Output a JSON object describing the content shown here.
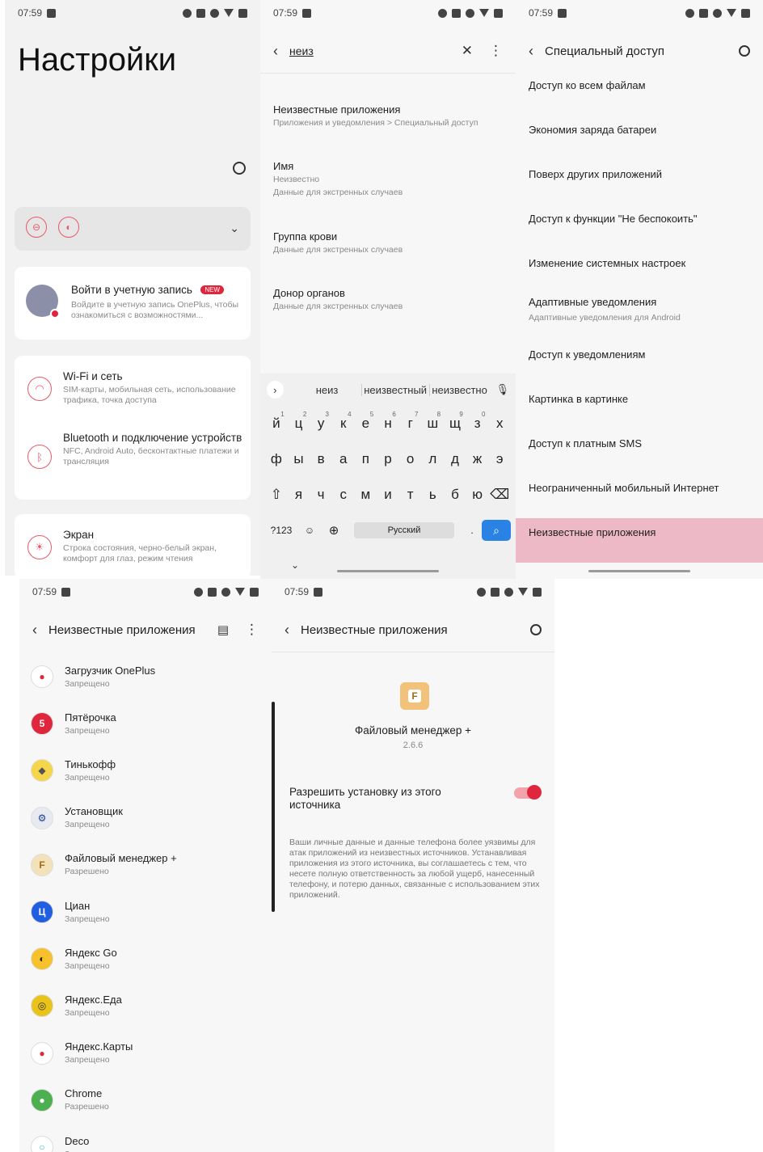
{
  "status": {
    "time": "07:59"
  },
  "settings": {
    "title": "Настройки",
    "account_title": "Войти в учетную запись",
    "account_badge": "NEW",
    "account_sub": "Войдите в учетную запись OnePlus, чтобы ознакомиться с возможностями...",
    "items": [
      {
        "title": "Wi-Fi и сеть",
        "sub": "SIM-карты, мобильная сеть, использование трафика, точка доступа"
      },
      {
        "title": "Bluetooth и подключение устройств",
        "sub": "NFC, Android Auto, бесконтактные платежи и трансляция"
      },
      {
        "title": "Экран",
        "sub": "Строка состояния, черно-белый экран, комфорт для глаз, режим чтения"
      }
    ]
  },
  "search": {
    "query": "неиз",
    "results": [
      {
        "title": "Неизвестные приложения",
        "sub1": "Приложения и уведомления > Специальный доступ",
        "sub2": ""
      },
      {
        "title": "Имя",
        "sub1": "Неизвестно",
        "sub2": "Данные для экстренных случаев"
      },
      {
        "title": "Группа крови",
        "sub1": "Данные для экстренных случаев",
        "sub2": ""
      },
      {
        "title": "Донор органов",
        "sub1": "Данные для экстренных случаев",
        "sub2": ""
      }
    ],
    "suggestions": [
      "неиз",
      "неизвестный",
      "неизвестно"
    ],
    "keyboard": {
      "row1": [
        "й",
        "ц",
        "у",
        "к",
        "е",
        "н",
        "г",
        "ш",
        "щ",
        "з",
        "х"
      ],
      "row1_nums": [
        "1",
        "2",
        "3",
        "4",
        "5",
        "6",
        "7",
        "8",
        "9",
        "0",
        ""
      ],
      "row2": [
        "ф",
        "ы",
        "в",
        "а",
        "п",
        "р",
        "о",
        "л",
        "д",
        "ж",
        "э"
      ],
      "row3": [
        "я",
        "ч",
        "с",
        "м",
        "и",
        "т",
        "ь",
        "б",
        "ю"
      ],
      "sym_key": "?123",
      "space_label": "Русский",
      "dot": "."
    }
  },
  "special_access": {
    "title": "Специальный доступ",
    "items": [
      {
        "title": "Доступ ко всем файлам",
        "sub": ""
      },
      {
        "title": "Экономия заряда батареи",
        "sub": ""
      },
      {
        "title": "Поверх других приложений",
        "sub": ""
      },
      {
        "title": "Доступ к функции \"Не беспокоить\"",
        "sub": ""
      },
      {
        "title": "Изменение системных настроек",
        "sub": ""
      },
      {
        "title": "Адаптивные уведомления",
        "sub": "Адаптивные уведомления для Android"
      },
      {
        "title": "Доступ к уведомлениям",
        "sub": ""
      },
      {
        "title": "Картинка в картинке",
        "sub": ""
      },
      {
        "title": "Доступ к платным SMS",
        "sub": ""
      },
      {
        "title": "Неограниченный мобильный Интернет",
        "sub": ""
      },
      {
        "title": "Неизвестные приложения",
        "sub": ""
      }
    ],
    "highlight_color": "#eeb9c6"
  },
  "unknown_apps": {
    "title": "Неизвестные приложения",
    "apps": [
      {
        "name": "Загрузчик OnePlus",
        "status": "Запрещено",
        "color": "#ffffff",
        "fg": "#e0263d",
        "glyph": "●"
      },
      {
        "name": "Пятёрочка",
        "status": "Запрещено",
        "color": "#e0263d",
        "fg": "#ffffff",
        "glyph": "5"
      },
      {
        "name": "Тинькофф",
        "status": "Запрещено",
        "color": "#f5d54a",
        "fg": "#555555",
        "glyph": "◆"
      },
      {
        "name": "Установщик",
        "status": "Запрещено",
        "color": "#e8eaf2",
        "fg": "#1a3f8f",
        "glyph": "⚙"
      },
      {
        "name": "Файловый менеджер +",
        "status": "Разрешено",
        "color": "#f3e1b9",
        "fg": "#a06a1a",
        "glyph": "F"
      },
      {
        "name": "Циан",
        "status": "Запрещено",
        "color": "#1f5fe0",
        "fg": "#ffffff",
        "glyph": "Ц"
      },
      {
        "name": "Яндекс Go",
        "status": "Запрещено",
        "color": "#f6c12c",
        "fg": "#222222",
        "glyph": "◐"
      },
      {
        "name": "Яндекс.Еда",
        "status": "Запрещено",
        "color": "#e9c21a",
        "fg": "#333333",
        "glyph": "◎"
      },
      {
        "name": "Яндекс.Карты",
        "status": "Запрещено",
        "color": "#ffffff",
        "fg": "#e0263d",
        "glyph": "●"
      },
      {
        "name": "Chrome",
        "status": "Разрешено",
        "color": "#4caf50",
        "fg": "#ffffff",
        "glyph": "●"
      },
      {
        "name": "Deco",
        "status": "Запрещено",
        "color": "#ffffff",
        "fg": "#21b3d6",
        "glyph": "○"
      }
    ]
  },
  "app_detail": {
    "title": "Неизвестные приложения",
    "app_name": "Файловый менеджер +",
    "version": "2.6.6",
    "toggle_label": "Разрешить установку из этого источника",
    "toggle_on": true,
    "warning": "Ваши личные данные и данные телефона более уязвимы для атак приложений из неизвестных источников. Устанавливая приложения из этого источника, вы соглашаетесь с тем, что несете полную ответственность за любой ущерб, нанесенный телефону, и потерю данных, связанные с использованием этих приложений."
  }
}
